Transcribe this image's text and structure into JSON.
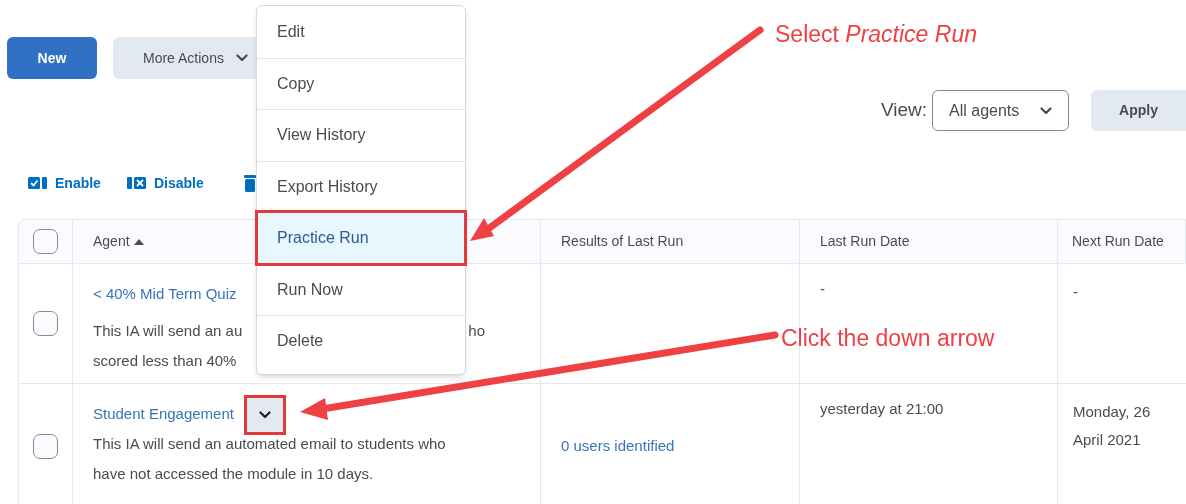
{
  "toolbar": {
    "buttons": [
      {
        "label": "New",
        "kind": "primary"
      },
      {
        "label": "More Actions",
        "kind": "dropdown"
      }
    ]
  },
  "filter": {
    "label": "View:",
    "value": "All agents",
    "apply": "Apply"
  },
  "bulk_actions": [
    {
      "kind": "enable",
      "label": "Enable"
    },
    {
      "kind": "disable",
      "label": "Disable"
    },
    {
      "kind": "delete"
    }
  ],
  "table": {
    "select_all_checked": false,
    "columns": [
      {
        "label": "Agent",
        "sorted_ascending": true
      },
      {
        "label": "Results of Last Run"
      },
      {
        "label": "Last Run Date"
      },
      {
        "label": "Next Run Date"
      }
    ],
    "rows": [
      {
        "checked": false,
        "title": "< 40% Mid Term Quiz",
        "description_lines": [
          {
            "left": "This IA will send an au",
            "right": "ho"
          },
          {
            "left": "scored less than 40%"
          }
        ],
        "last_run": "-",
        "next_run": "-"
      },
      {
        "checked": false,
        "title": "Student Engagement",
        "menu_button": {
          "highlighted": true
        },
        "description": "This IA will send an automated email to students who have not accessed the module in 10 days.",
        "results": "0 users identified",
        "last_run": "yesterday at 21:00",
        "next_run": "Monday, 26 April 2021"
      }
    ]
  },
  "context_menu": {
    "items": [
      {
        "label": "Edit",
        "selected": false,
        "highlighted": false
      },
      {
        "label": "Copy",
        "selected": false,
        "highlighted": false
      },
      {
        "label": "View History",
        "selected": false,
        "highlighted": false
      },
      {
        "label": "Export History",
        "selected": false,
        "highlighted": false
      },
      {
        "label": "Practice Run",
        "selected": true,
        "highlighted": true
      },
      {
        "label": "Run Now",
        "selected": false,
        "highlighted": false
      },
      {
        "label": "Delete",
        "selected": false,
        "highlighted": false
      }
    ]
  },
  "annotations": [
    {
      "text": "Select *Practice Run*"
    },
    {
      "text": "Click the down arrow"
    }
  ]
}
